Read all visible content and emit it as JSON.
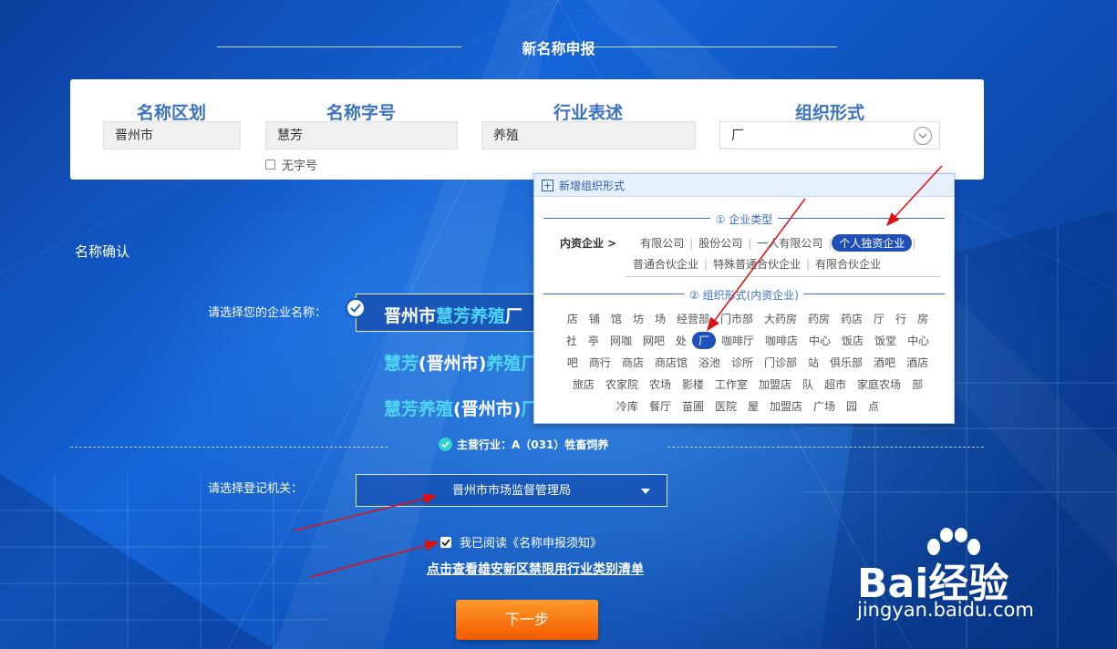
{
  "header": {
    "title": "新名称申报"
  },
  "name_panel": {
    "region": {
      "label": "名称区划",
      "value": "晋州市"
    },
    "zihao": {
      "label": "名称字号",
      "value": "慧芳",
      "no_zihao_label": "无字号"
    },
    "industry": {
      "label": "行业表述",
      "value": "养殖"
    },
    "org_form": {
      "label": "组织形式",
      "value": "厂"
    }
  },
  "confirm": {
    "section_label": "名称确认",
    "choose_name_label": "请选择您的企业名称：",
    "options": [
      {
        "part1": "晋州市",
        "part2": "慧芳养殖",
        "part3": "厂"
      },
      {
        "part1": "慧芳",
        "part2": "(晋州市)",
        "part3": "养殖厂"
      },
      {
        "part1": "慧芳养殖",
        "part2": "(晋州市)",
        "part3": "厂"
      }
    ],
    "main_industry": "主营行业：A（031）牲畜饲养",
    "reg_label": "请选择登记机关：",
    "reg_value": "晋州市市场监督管理局",
    "read_notice": "我已阅读《名称申报须知》",
    "xiongan_link": "点击查看雄安新区禁限用行业类别清单",
    "next_button": "下一步"
  },
  "org_dropdown": {
    "header": "新增组织形式",
    "section1_title": "① 企业类型",
    "lead": "内资企业 >",
    "types_row1": [
      "有限公司",
      "股份公司",
      "一人有限公司",
      "个人独资企业"
    ],
    "types_row2": [
      "普通合伙企业",
      "特殊普通合伙企业",
      "有限合伙企业"
    ],
    "active_type": "个人独资企业",
    "section2_title": "② 组织形式(内资企业)",
    "forms_rows": [
      [
        "店",
        "铺",
        "馆",
        "坊",
        "场",
        "经营部",
        "门市部",
        "大药房",
        "药房",
        "药店",
        "厅",
        "行",
        "房"
      ],
      [
        "社",
        "亭",
        "网咖",
        "网吧",
        "处",
        "厂",
        "咖啡厅",
        "咖啡店",
        "中心",
        "饭店",
        "饭堂",
        "中心"
      ],
      [
        "吧",
        "商行",
        "商店",
        "商店馆",
        "浴池",
        "诊所",
        "门诊部",
        "站",
        "俱乐部",
        "酒吧",
        "酒店"
      ],
      [
        "旅店",
        "农家院",
        "农场",
        "影楼",
        "工作室",
        "加盟店",
        "队",
        "超市",
        "家庭农场",
        "部"
      ],
      [
        "冷库",
        "餐厅",
        "苗圃",
        "医院",
        "屋",
        "加盟店",
        "广场",
        "园",
        "点"
      ]
    ],
    "active_form": "厂"
  },
  "watermark": {
    "main": "Bai经验",
    "url": "jingyan.baidu.com"
  },
  "colors": {
    "accent_blue": "#1f4fb8",
    "cyan_text": "#4fd6f2",
    "button_orange": "#f25a00"
  }
}
